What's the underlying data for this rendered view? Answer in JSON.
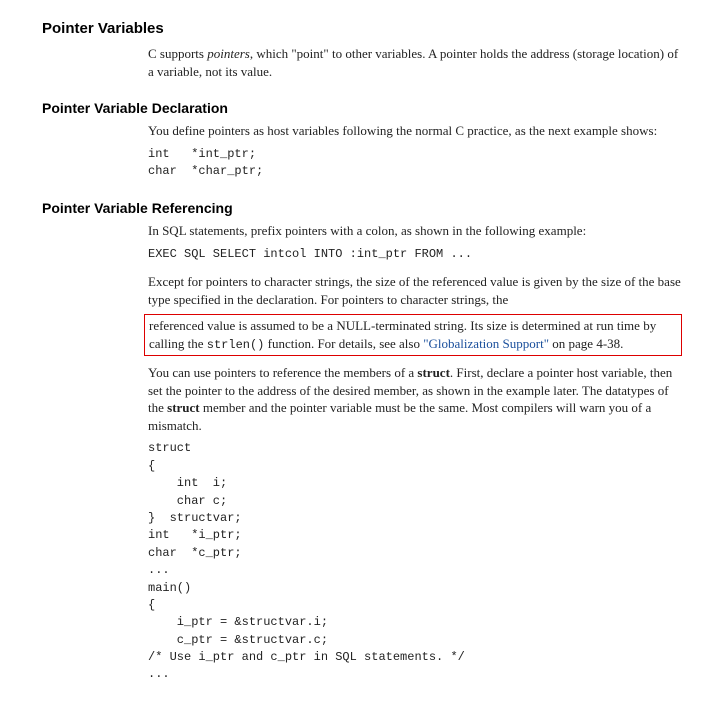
{
  "section1": {
    "heading": "Pointer Variables",
    "para1_a": "C supports ",
    "para1_italic": "pointers",
    "para1_b": ", which \"point\" to other variables. A pointer holds the address (storage location) of a variable, not its value."
  },
  "section2": {
    "heading": "Pointer Variable Declaration",
    "para1": "You define pointers as host variables following the normal C practice, as the next example shows:",
    "code1": "int   *int_ptr;\nchar  *char_ptr;"
  },
  "section3": {
    "heading": "Pointer Variable Referencing",
    "para1": "In SQL statements, prefix pointers with a colon, as shown in the following example:",
    "code1": "EXEC SQL SELECT intcol INTO :int_ptr FROM ...",
    "para2": "Except for pointers to character strings, the size of the referenced value is given by the size of the base type specified in the declaration. For pointers to character strings, the",
    "highlight_a": "referenced value is assumed to be a NULL-terminated string. Its size is determined at run time by calling the ",
    "highlight_mono": "strlen()",
    "highlight_b": " function. For details, see also ",
    "highlight_link": "\"Globalization Support\"",
    "highlight_c": " on page 4-38.",
    "para3_a": "You can use pointers to reference the members of a ",
    "para3_bold": "struct",
    "para3_b": ". First, declare a pointer host variable, then set the pointer to the address of the desired member, as shown in the example later. The datatypes of the ",
    "para3_bold2": "struct",
    "para3_c": " member and the pointer variable must be the same. Most compilers will warn you of a mismatch.",
    "code2": "struct\n{\n    int  i;\n    char c;\n}  structvar;\nint   *i_ptr;\nchar  *c_ptr;\n...\nmain()\n{\n    i_ptr = &structvar.i;\n    c_ptr = &structvar.c;\n/* Use i_ptr and c_ptr in SQL statements. */\n..."
  }
}
